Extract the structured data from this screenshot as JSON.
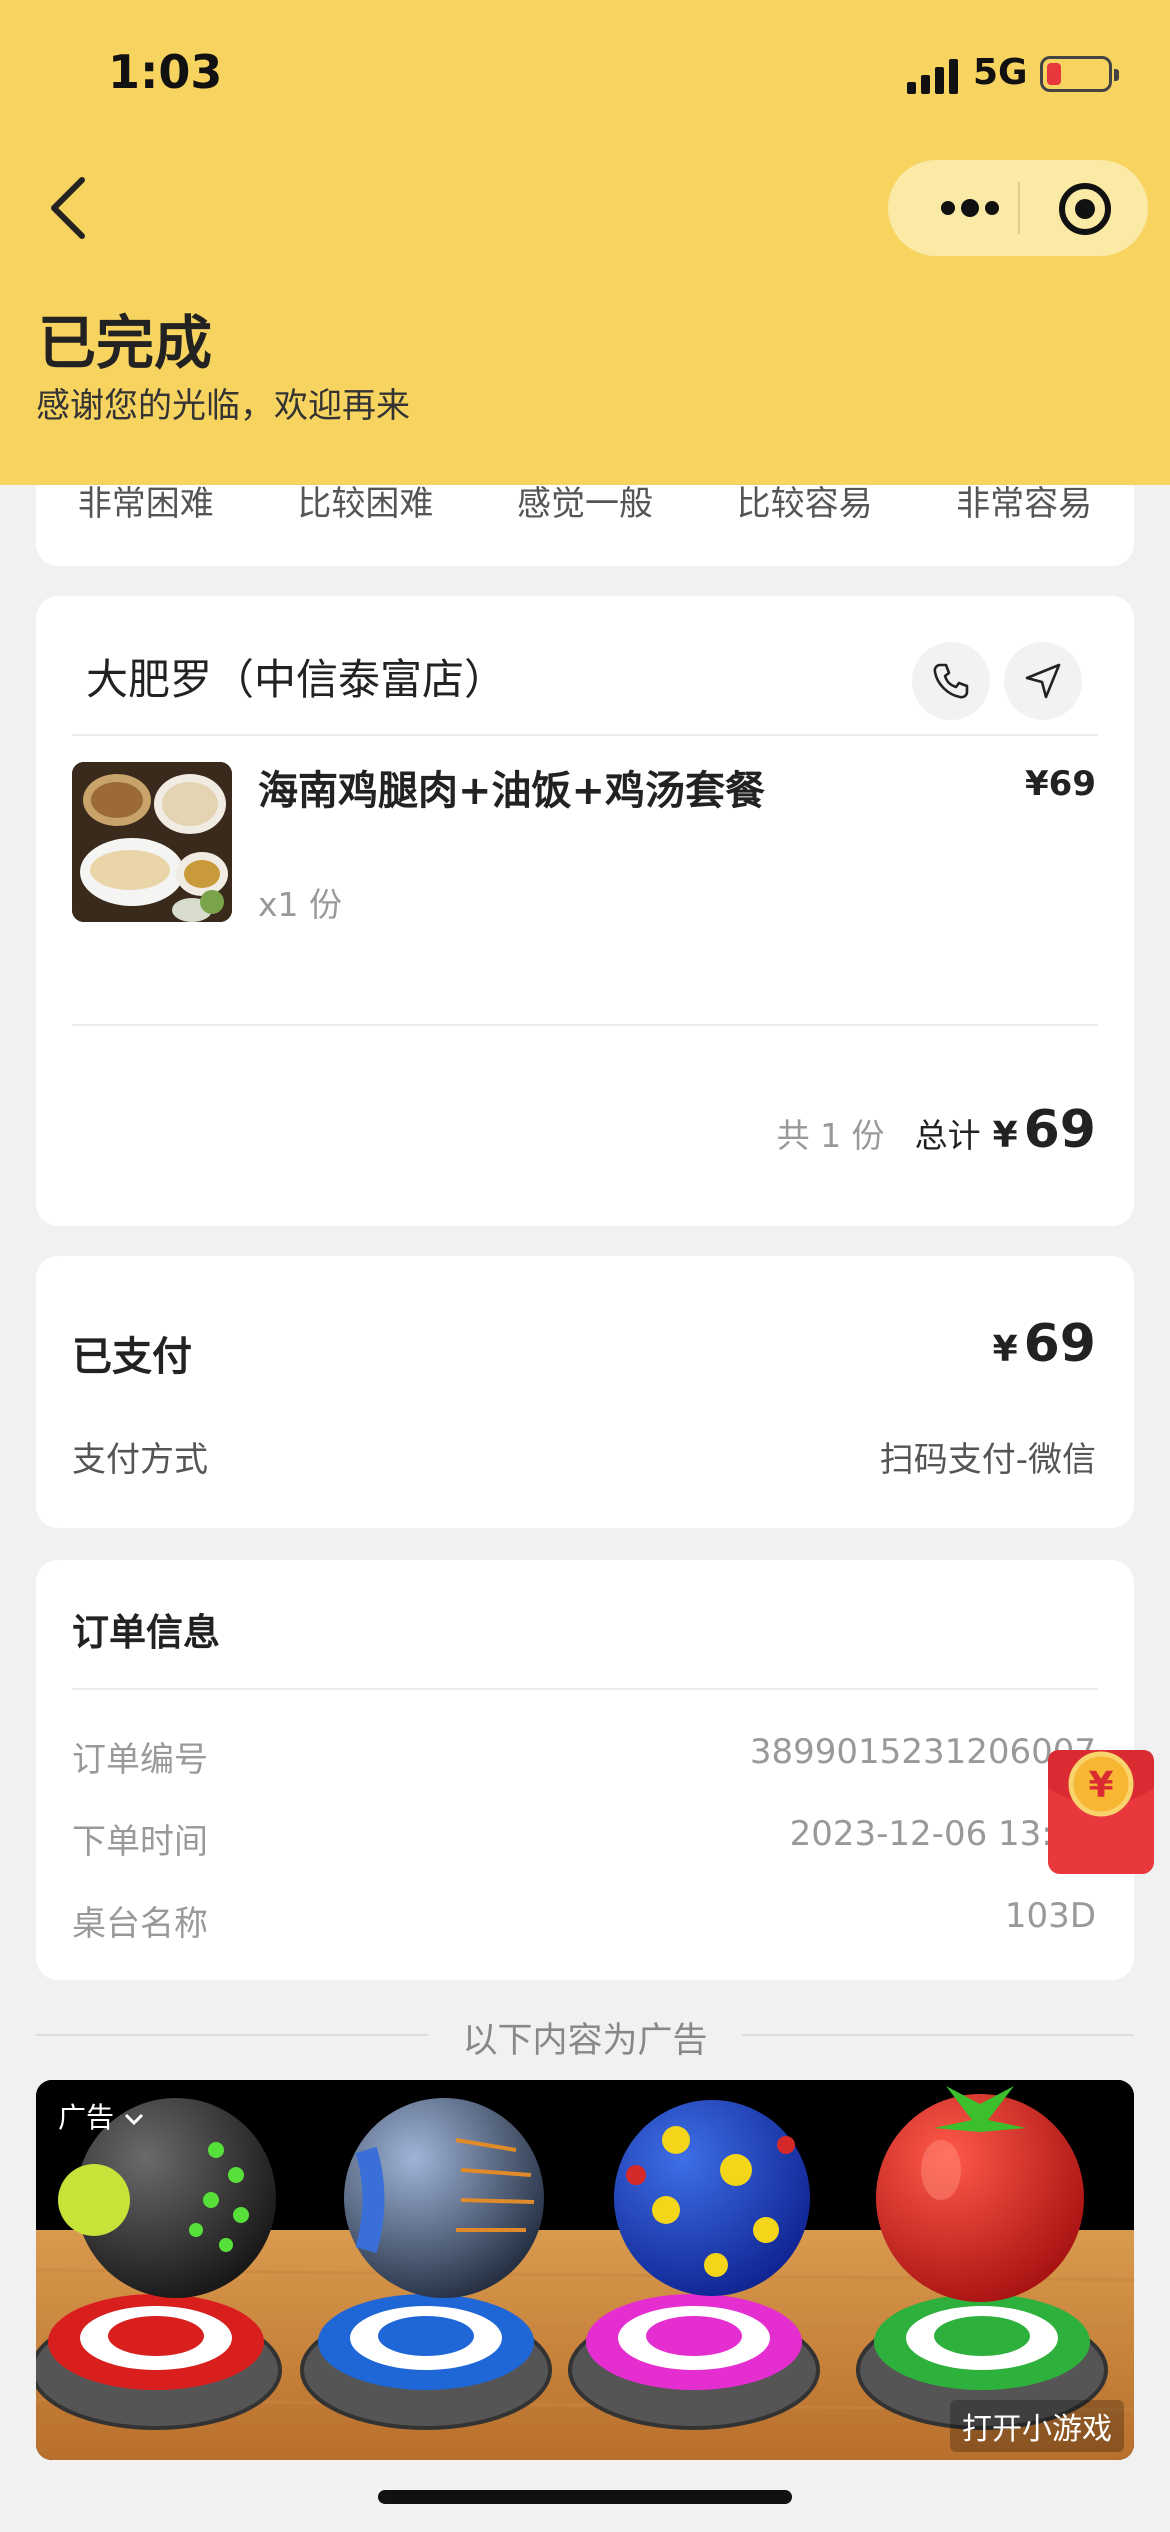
{
  "status_bar": {
    "time": "1:03",
    "network": "5G"
  },
  "header": {
    "title": "已完成",
    "subtitle": "感谢您的光临，欢迎再来"
  },
  "rating": {
    "options": [
      "非常困难",
      "比较困难",
      "感觉一般",
      "比较容易",
      "非常容易"
    ]
  },
  "shop": {
    "name": "大肥罗（中信泰富店）",
    "dish": {
      "name": "海南鸡腿肉+油饭+鸡汤套餐",
      "price": "¥69",
      "qty": "x1 份"
    },
    "summary": {
      "count": "共 1 份",
      "total_label": "总计",
      "currency": "¥",
      "total": "69"
    }
  },
  "payment": {
    "status": "已支付",
    "currency": "¥",
    "amount": "69",
    "method_label": "支付方式",
    "method_value": "扫码支付-微信"
  },
  "order": {
    "title": "订单信息",
    "rows": [
      {
        "label": "订单编号",
        "value": "3899015231206007"
      },
      {
        "label": "下单时间",
        "value": "2023-12-06 13:02"
      },
      {
        "label": "桌台名称",
        "value": "103D"
      }
    ]
  },
  "ad": {
    "divider": "以下内容为广告",
    "tag": "广告",
    "cta": "打开小游戏"
  },
  "colors": {
    "header_bg": "#f7d35f",
    "capsule_bg": "#fbeaa6",
    "page_bg": "#f1f1f1",
    "redpack": "#e8383d"
  }
}
